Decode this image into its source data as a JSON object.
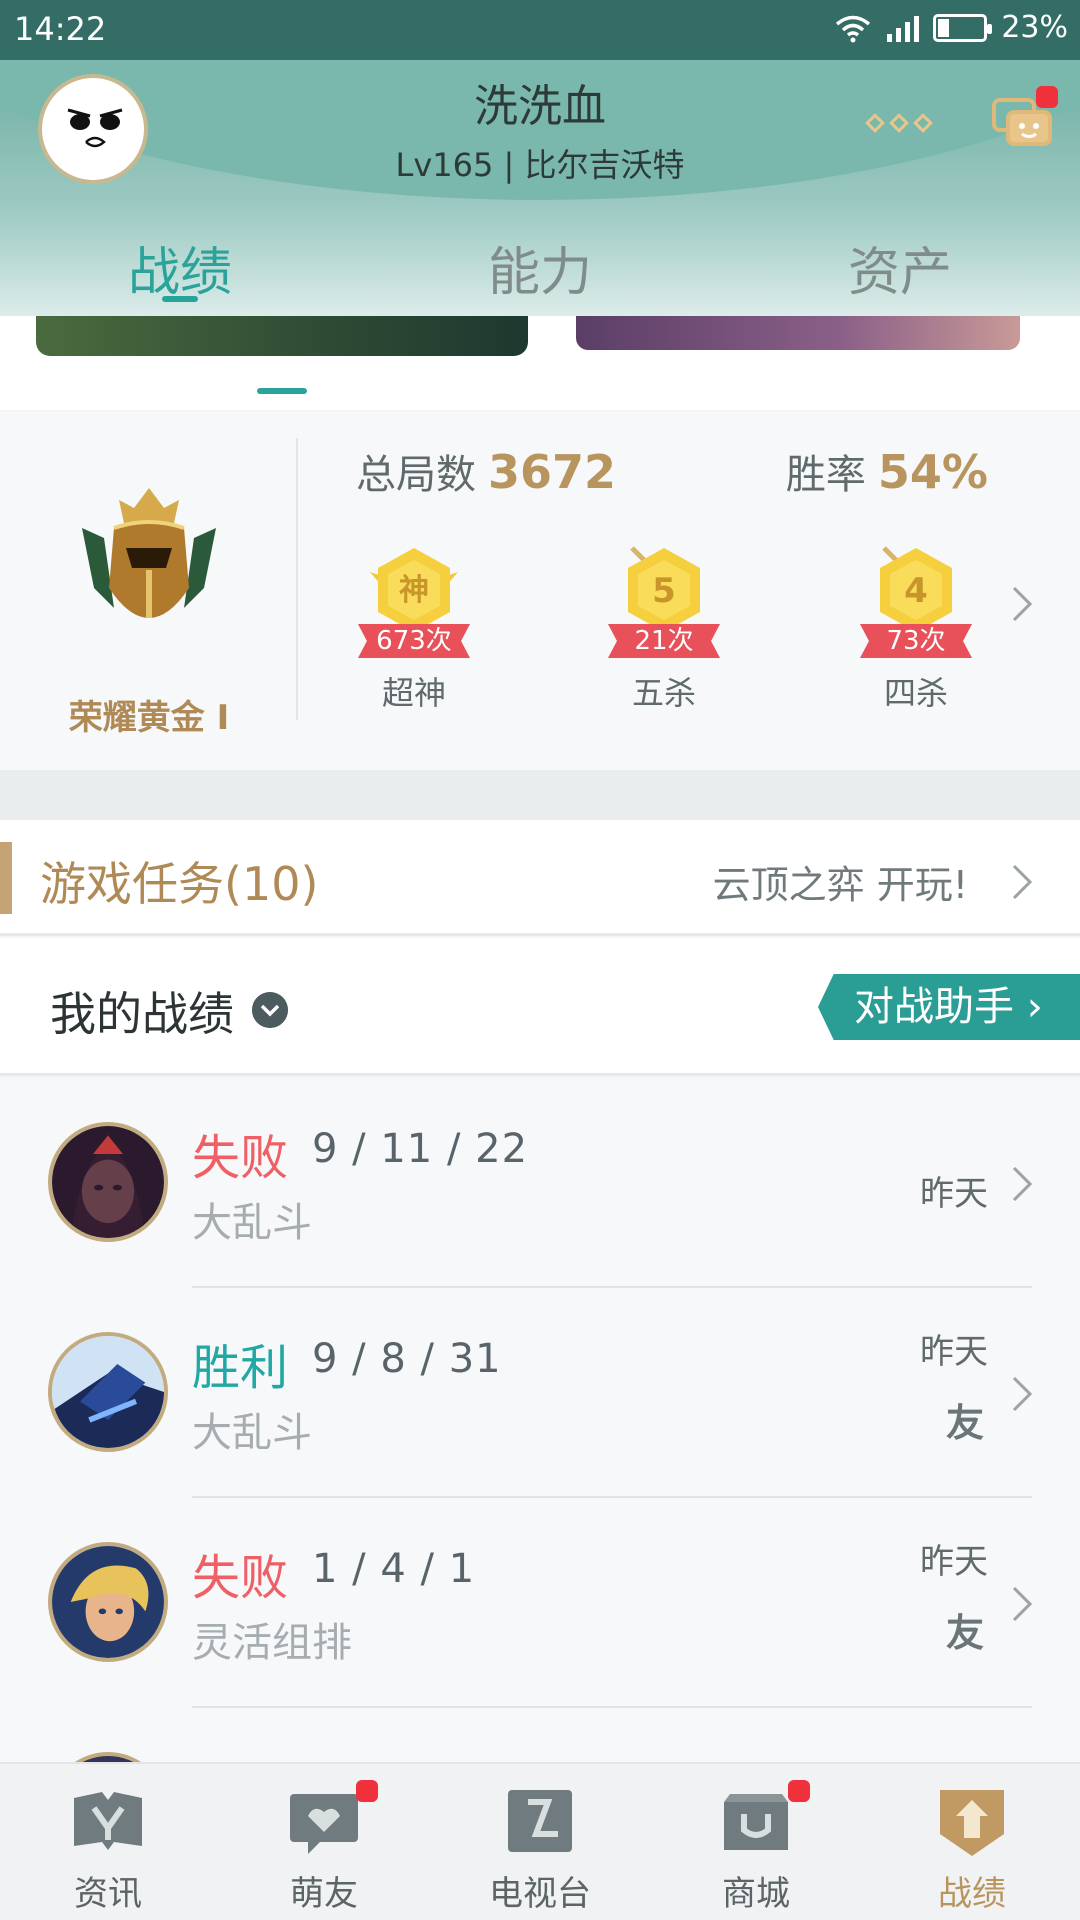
{
  "status_bar": {
    "time": "14:22",
    "battery": "23%",
    "battery_level": 0.23
  },
  "header": {
    "username": "洗洗血",
    "level_line": "Lv165 | 比尔吉沃特",
    "tabs": [
      {
        "label": "战绩",
        "active": true
      },
      {
        "label": "能力",
        "active": false
      },
      {
        "label": "资产",
        "active": false
      }
    ]
  },
  "rank": {
    "name": "荣耀黄金 I"
  },
  "stats": {
    "total_games_label": "总局数",
    "total_games": "3672",
    "win_rate_label": "胜率",
    "win_rate": "54%",
    "badges": [
      {
        "icon": "legendary-badge-icon",
        "glyph": "神",
        "count": "673次",
        "label": "超神"
      },
      {
        "icon": "pentakill-badge-icon",
        "glyph": "5",
        "count": "21次",
        "label": "五杀"
      },
      {
        "icon": "quadrakill-badge-icon",
        "glyph": "4",
        "count": "73次",
        "label": "四杀"
      }
    ]
  },
  "tasks": {
    "title": "游戏任务(10)",
    "promo": "云顶之弈 开玩!"
  },
  "my_record": {
    "title": "我的战绩",
    "assistant_button": "对战助手 ›"
  },
  "matches": [
    {
      "result": "失败",
      "result_type": "lose",
      "kda": "9 / 11 / 22",
      "mode": "大乱斗",
      "time": "昨天",
      "friend": ""
    },
    {
      "result": "胜利",
      "result_type": "win",
      "kda": "9 / 8 / 31",
      "mode": "大乱斗",
      "time": "昨天",
      "friend": "友"
    },
    {
      "result": "失败",
      "result_type": "lose",
      "kda": "1 / 4 / 1",
      "mode": "灵活组排",
      "time": "昨天",
      "friend": "友"
    }
  ],
  "bottom_nav": [
    {
      "label": "资讯",
      "icon": "news-icon",
      "badge": false,
      "active": false
    },
    {
      "label": "萌友",
      "icon": "friends-icon",
      "badge": true,
      "active": false
    },
    {
      "label": "电视台",
      "icon": "tv-icon",
      "badge": false,
      "active": false
    },
    {
      "label": "商城",
      "icon": "shop-icon",
      "badge": true,
      "active": false
    },
    {
      "label": "战绩",
      "icon": "record-icon",
      "badge": false,
      "active": true
    }
  ],
  "colors": {
    "accent": "#2aa39a",
    "gold": "#b8945e",
    "lose": "#ef5f66",
    "win": "#22a8a4",
    "badge_red": "#f0303a"
  }
}
